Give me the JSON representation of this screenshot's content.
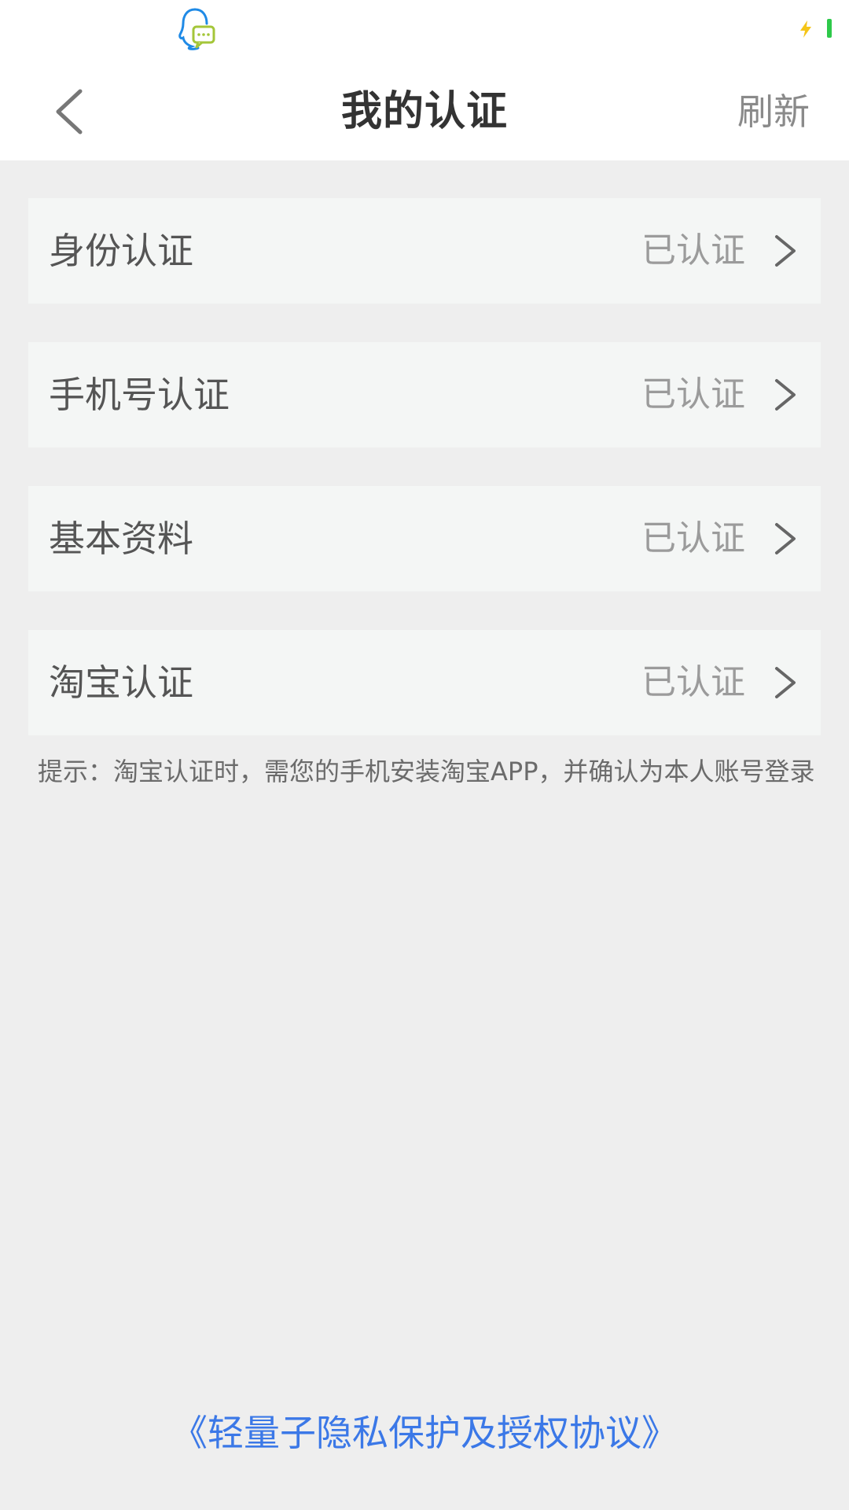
{
  "header": {
    "title": "我的认证",
    "refresh_label": "刷新"
  },
  "auth_items": [
    {
      "label": "身份认证",
      "status": "已认证"
    },
    {
      "label": "手机号认证",
      "status": "已认证"
    },
    {
      "label": "基本资料",
      "status": "已认证"
    },
    {
      "label": "淘宝认证",
      "status": "已认证"
    }
  ],
  "tip": "提示：淘宝认证时，需您的手机安装淘宝APP，并确认为本人账号登录",
  "privacy_link": "《轻量子隐私保护及授权协议》",
  "icons": {
    "status_app": "qq-icon",
    "charging": "lightning-icon",
    "back": "chevron-left-icon",
    "item_arrow": "chevron-right-icon"
  },
  "colors": {
    "accent_link": "#3b78e7",
    "item_background": "#f4f6f5",
    "page_background": "#eeeeee",
    "battery": "#2ec94a",
    "charging": "#f5c518"
  }
}
